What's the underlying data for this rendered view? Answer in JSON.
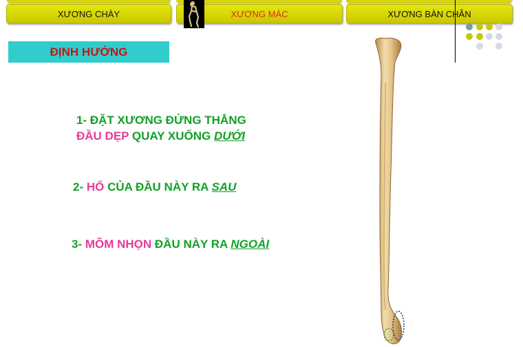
{
  "nav": {
    "tabs": [
      {
        "label": "XƯƠNG CHÀY",
        "active": false
      },
      {
        "label": "XƯƠNG MÁC",
        "active": true
      },
      {
        "label": "XƯƠNG BÀN CHÂN",
        "active": false
      }
    ],
    "active_color": "#e8271c",
    "button_color": "#d7d600"
  },
  "heading": {
    "label": "ĐỊNH HƯỚNG",
    "bg_color": "#33cccc",
    "text_color": "#c81414"
  },
  "steps": {
    "s1": {
      "line1": "1- ĐẶT XƯƠNG ĐỨNG THẲNG",
      "part_a": "ĐẦU DẸP",
      "part_b": " QUAY XUỐNG ",
      "part_c": "DƯỚI"
    },
    "s2": {
      "prefix": "2- ",
      "part_a": "HỐ",
      "part_b": " CỦA ĐẦU NÀY RA ",
      "part_c": "SAU"
    },
    "s3": {
      "prefix": "3- ",
      "part_a": "MÕM NHỌN",
      "part_b": " ĐẦU NÀY RA ",
      "part_c": "NGOÀI"
    }
  },
  "colors": {
    "green": "#11a026",
    "pink": "#e83a98"
  },
  "decor": {
    "dot_colors": [
      "#7f9aa0",
      "#c8c800",
      "#d8d8e6"
    ]
  }
}
